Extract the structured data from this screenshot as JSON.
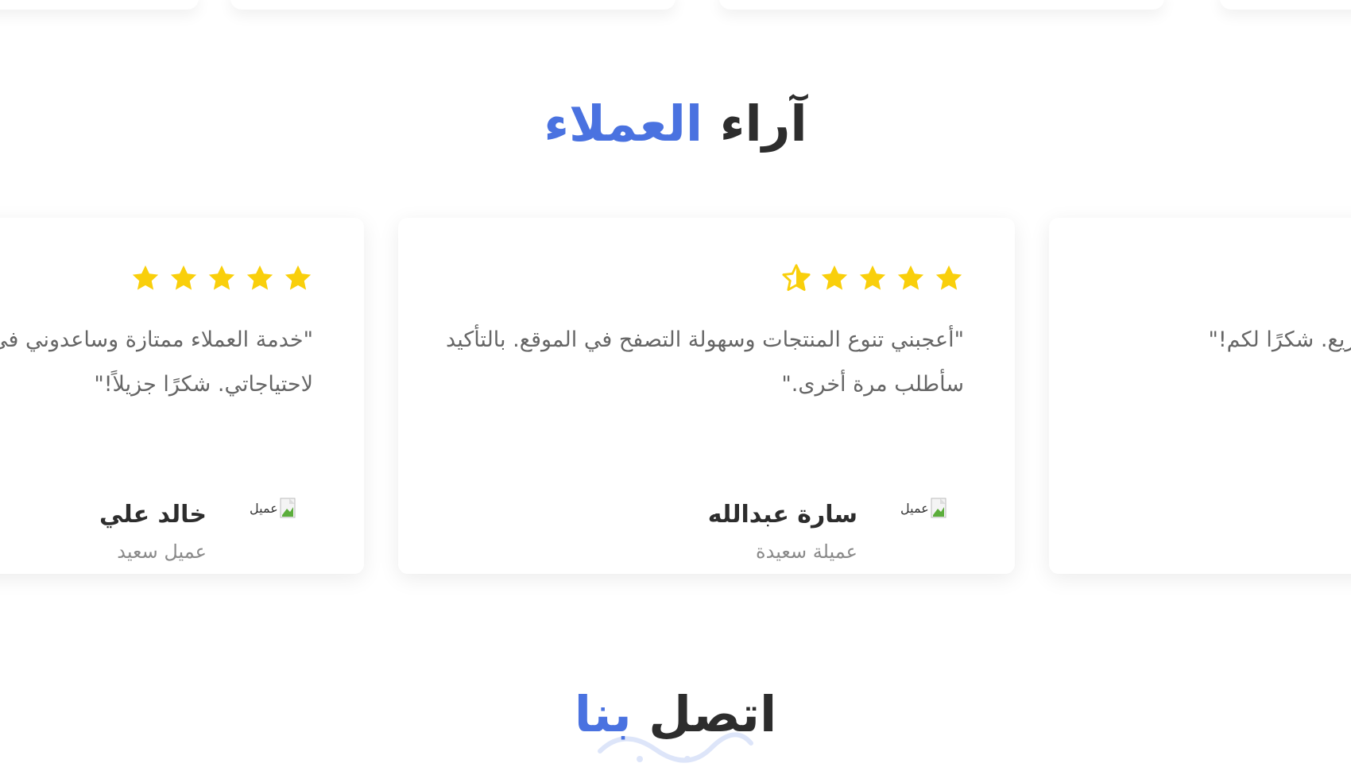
{
  "testimonials_section": {
    "title_plain": "آراء",
    "title_accent": "العملاء"
  },
  "testimonials": [
    {
      "quote": "\"خدمة العملاء ممتازة وساعدوني في اختيار المنتج المناسب لاحتياجاتي. شكرًا جزيلاً!\"",
      "rating": 5,
      "author_name": "خالد علي",
      "author_role": "عميل سعيد",
      "avatar_alt": "عميل"
    },
    {
      "quote": "\"أعجبني تنوع المنتجات وسهولة التصفح في الموقع. بالتأكيد سأطلب مرة أخرى.\"",
      "rating": 4.5,
      "author_name": "سارة عبدالله",
      "author_role": "عميلة سعيدة",
      "avatar_alt": "عميل"
    },
    {
      "quote": "\"منتجات ذات جودة عالية وتوصيل سريع. شكرًا لكم!\""
    }
  ],
  "contact_section": {
    "title_plain": "اتصل",
    "title_accent": "بنا"
  },
  "colors": {
    "accent": "#4a72e0",
    "star": "#f9cf0b",
    "heading": "#2d2d2d",
    "body_text": "#666666"
  },
  "icons": {
    "star": "star-icon",
    "half_star": "half-star-icon",
    "broken_image": "broken-image-icon"
  }
}
